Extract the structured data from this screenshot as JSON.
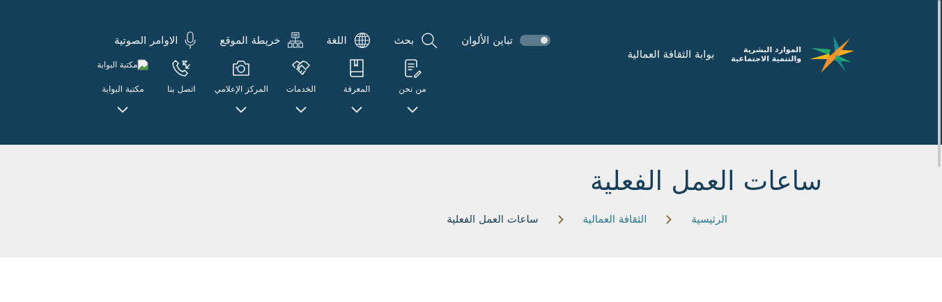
{
  "logo": {
    "org_line_1": "الموارد البشرية",
    "org_line_2": "والتنمية الاجتماعية",
    "portal": "بوابة الثقافة العمالية"
  },
  "toolbar": {
    "contrast": {
      "label": "تباين الألوان",
      "on": true
    },
    "items": [
      {
        "label": "بحث"
      },
      {
        "label": "اللغة"
      },
      {
        "label": "خريطة الموقع"
      },
      {
        "label": "الاوامر الصوتية"
      }
    ]
  },
  "nav": [
    {
      "label": "من نحن",
      "has_menu": true
    },
    {
      "label": "المعرفة",
      "has_menu": true
    },
    {
      "label": "الخدمات",
      "has_menu": true
    },
    {
      "label": "المركز الإعلامي",
      "has_menu": true
    },
    {
      "label": "اتصل بنا",
      "has_menu": false
    },
    {
      "label": "مكتبة البوابة",
      "has_menu": true,
      "broken_image_alt": "مكتبة البوابة"
    }
  ],
  "page_title": "ساعات العمل الفعلية",
  "breadcrumb": [
    {
      "label": "الرئيسية",
      "current": false
    },
    {
      "label": "الثقافة العمالية",
      "current": false
    },
    {
      "label": "ساعات العمل الفعلية",
      "current": true
    }
  ]
}
